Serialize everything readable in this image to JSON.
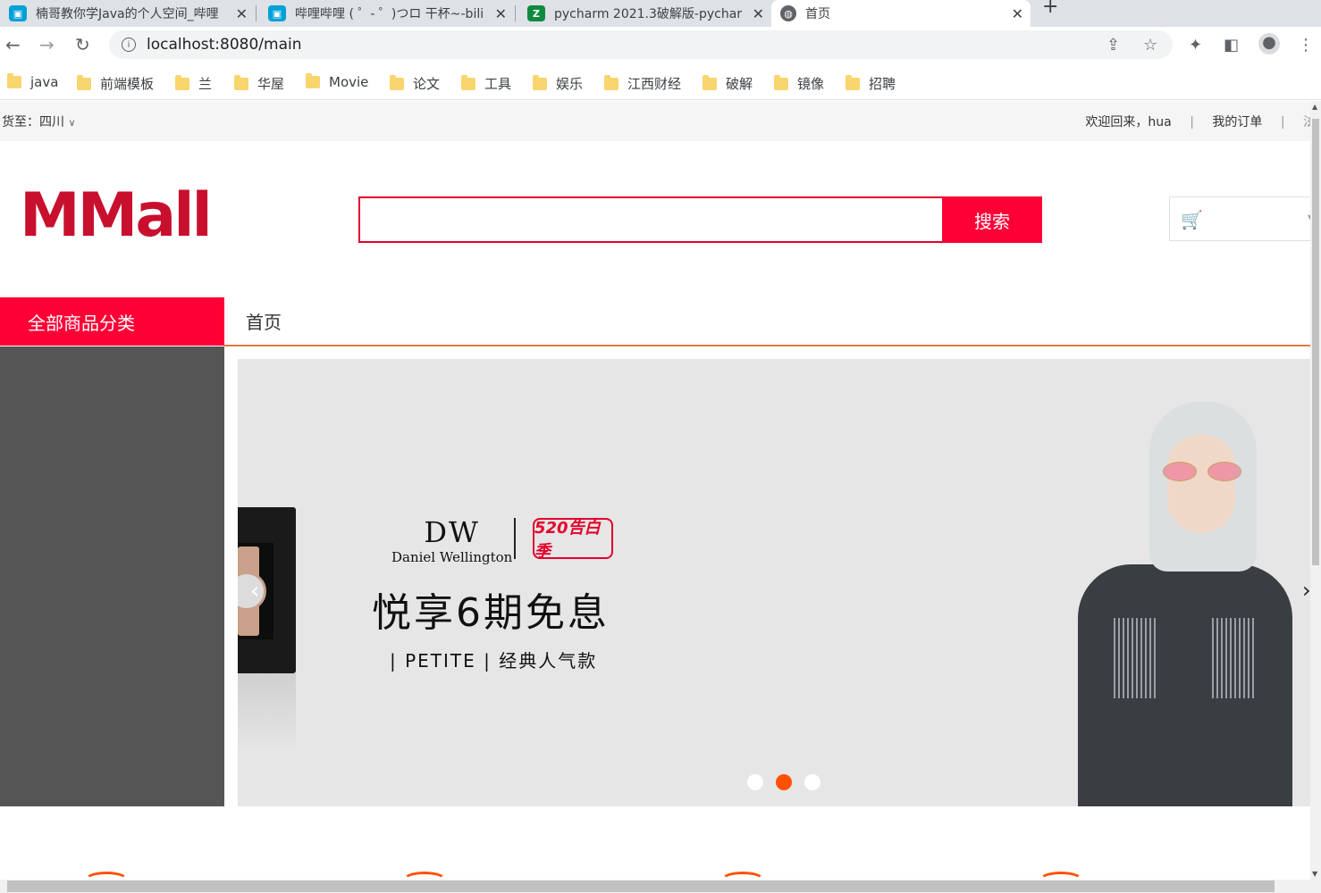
{
  "browser": {
    "tabs": [
      {
        "title": "楠哥教你学Java的个人空间_哔哩",
        "icon": "bilibili-icon"
      },
      {
        "title": "哔哩哔哩 ( ゜- ゜)つロ 干杯~-bili",
        "icon": "bilibili-icon"
      },
      {
        "title": "pycharm 2021.3破解版-pycharm",
        "icon": "zhihu-z-icon"
      },
      {
        "title": "首页",
        "icon": "globe-icon"
      }
    ],
    "url": "localhost:8080/main",
    "bookmarks": [
      "java",
      "前端模板",
      "兰",
      "华屋",
      "Movie",
      "论文",
      "工具",
      "娱乐",
      "江西财经",
      "破解",
      "镜像",
      "招聘"
    ]
  },
  "topbar": {
    "ship_to": "货至：四川",
    "welcome": "欢迎回来，hua",
    "sep1": "|",
    "orders": "我的订单",
    "sep2": "|",
    "cut_text": "泫"
  },
  "header": {
    "logo": "MMall",
    "search_placeholder": "",
    "search_button": "搜索"
  },
  "nav": {
    "category_button": "全部商品分类",
    "home": "首页"
  },
  "banner": {
    "brand_logo": "DW",
    "brand_name": "Daniel Wellington",
    "campaign": "520告白季",
    "headline": "悦享6期免息",
    "subline": "| PETITE | 经典人气款",
    "active_slide": 2,
    "slide_count": 3
  },
  "colors": {
    "accent": "#ff0036",
    "nav_underline": "#e4793c",
    "dot_active": "#ff5000"
  }
}
